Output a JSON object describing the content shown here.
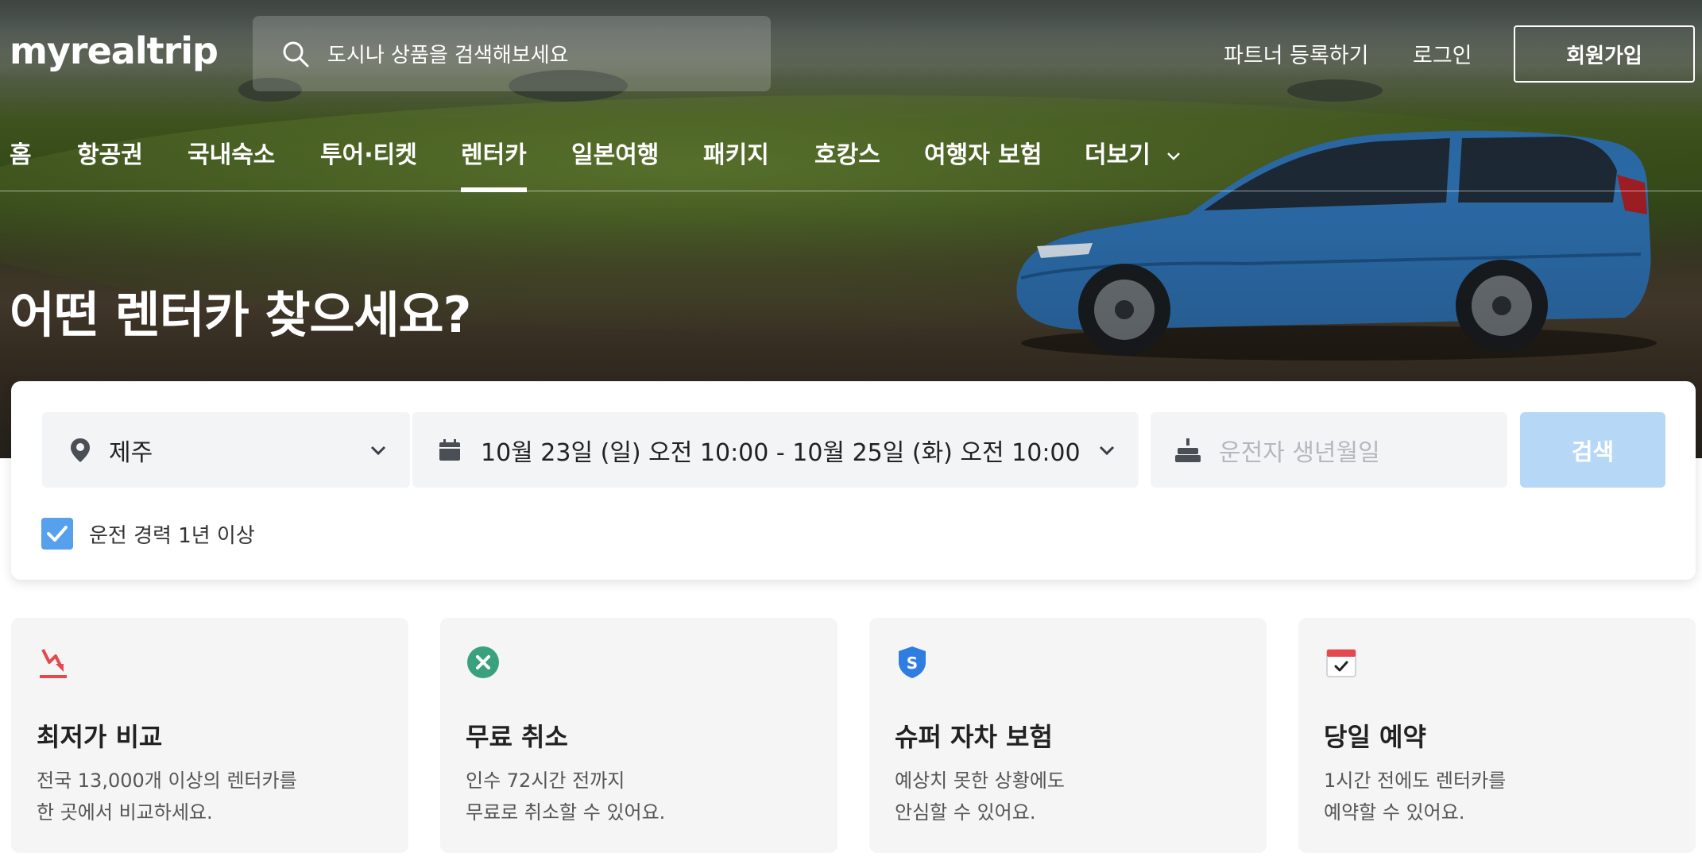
{
  "header": {
    "logo": "myrealtrip",
    "search_placeholder": "도시나 상품을 검색해보세요",
    "partner_link": "파트너 등록하기",
    "login_link": "로그인",
    "signup_button": "회원가입"
  },
  "nav": {
    "items": [
      {
        "label": "홈"
      },
      {
        "label": "항공권"
      },
      {
        "label": "국내숙소"
      },
      {
        "label": "투어·티켓"
      },
      {
        "label": "렌터카",
        "active": true
      },
      {
        "label": "일본여행"
      },
      {
        "label": "패키지"
      },
      {
        "label": "호캉스"
      },
      {
        "label": "여행자 보험"
      },
      {
        "label": "더보기"
      }
    ]
  },
  "hero": {
    "title": "어떤 렌터카 찾으세요?"
  },
  "search_form": {
    "location": "제주",
    "dates": "10월 23일 (일) 오전 10:00 - 10월 25일 (화) 오전 10:00",
    "birthdate_placeholder": "운전자 생년월일",
    "search_button": "검색",
    "experience_checkbox": {
      "label": "운전 경력 1년 이상",
      "checked": true
    }
  },
  "features": [
    {
      "icon": "price-drop-icon",
      "title": "최저가 비교",
      "desc": [
        "전국 13,000개 이상의 렌터카를",
        "한 곳에서 비교하세요."
      ]
    },
    {
      "icon": "cancel-circle-icon",
      "title": "무료 취소",
      "desc": [
        "인수 72시간 전까지",
        "무료로 취소할 수 있어요."
      ]
    },
    {
      "icon": "shield-icon",
      "title": "슈퍼 자차 보험",
      "desc": [
        "예상치 못한 상황에도",
        "안심할 수 있어요."
      ]
    },
    {
      "icon": "calendar-check-icon",
      "title": "당일 예약",
      "desc": [
        "1시간 전에도 렌터카를",
        "예약할 수 있어요."
      ]
    }
  ],
  "colors": {
    "accent_disabled": "#b7d7f7",
    "checkbox": "#56a0ed",
    "icon_red": "#e5484d",
    "icon_green": "#3aa17e",
    "icon_blue": "#2f7de1"
  }
}
